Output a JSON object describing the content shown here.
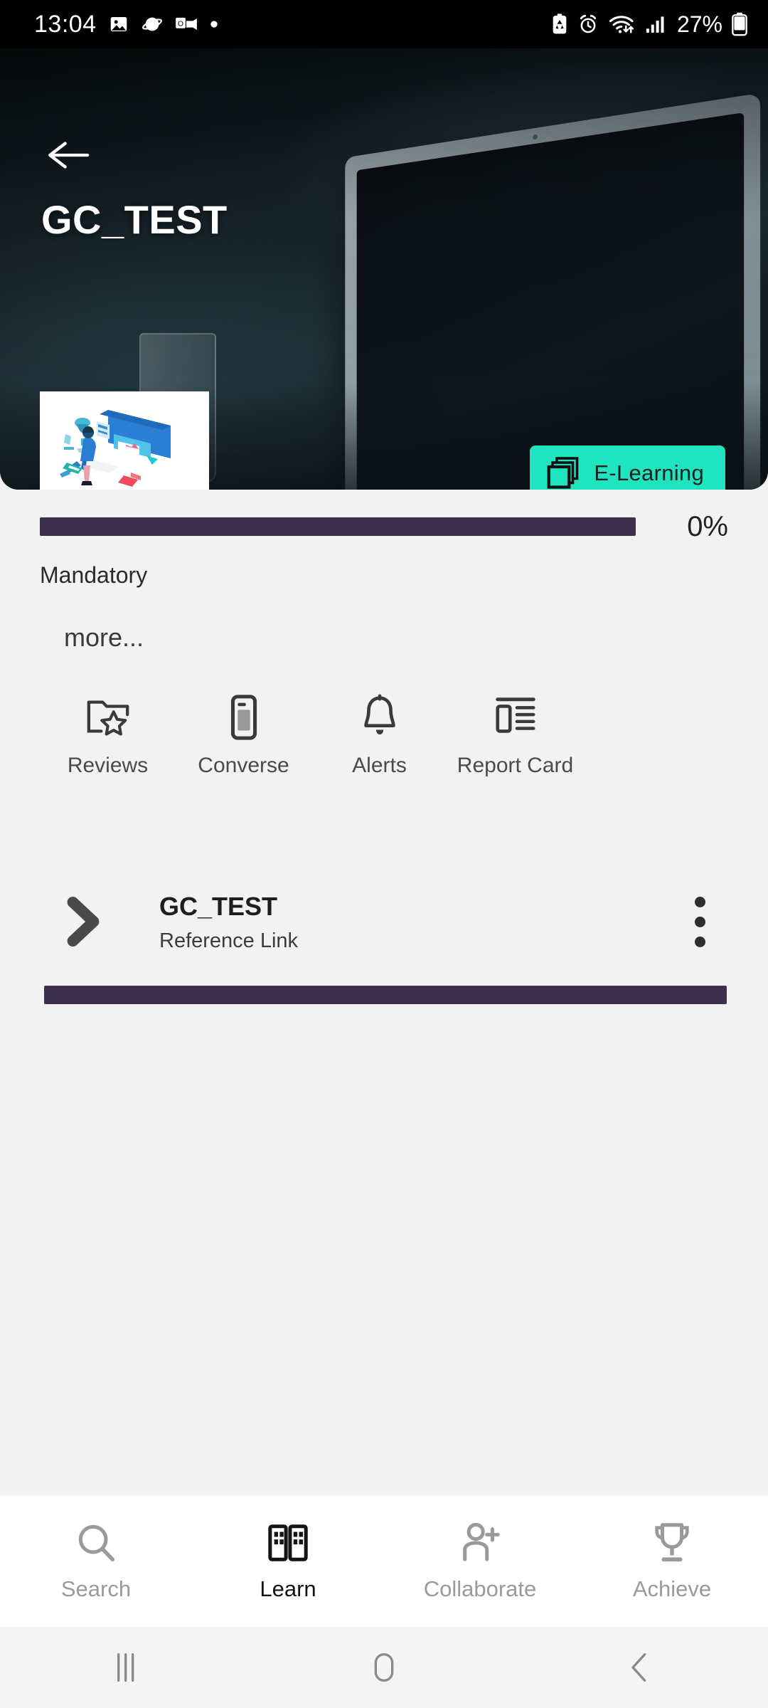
{
  "statusbar": {
    "time": "13:04",
    "battery_percent": "27%",
    "left_icons": [
      "photo-icon",
      "browser-planet-icon",
      "outlook-meeting-icon",
      "dot-icon"
    ],
    "right_icons": [
      "battery-saver-icon",
      "alarm-icon",
      "wifi-icon",
      "signal-icon",
      "battery-icon"
    ]
  },
  "hero": {
    "back_icon": "back-arrow-icon",
    "title": "GC_TEST",
    "thumbnail_alt": "course-thumbnail",
    "badge": {
      "label": "E-Learning",
      "icon": "stacked-squares-icon",
      "color": "#20e3c0"
    }
  },
  "progress": {
    "percent_label": "0%",
    "percent_value": 0,
    "track_color": "#3b2f4c",
    "category": "Mandatory",
    "more_label": "more..."
  },
  "actions": [
    {
      "label": "Reviews",
      "icon": "folder-star-icon"
    },
    {
      "label": "Converse",
      "icon": "mobile-phone-icon"
    },
    {
      "label": "Alerts",
      "icon": "bell-icon"
    },
    {
      "label": "Report Card",
      "icon": "report-card-icon"
    }
  ],
  "content_row": {
    "chevron_icon": "chevron-right-icon",
    "title": "GC_TEST",
    "subtitle": "Reference Link",
    "overflow_icon": "three-dot-menu-icon"
  },
  "bottom_nav": {
    "items": [
      {
        "label": "Search",
        "icon": "search-icon",
        "active": false
      },
      {
        "label": "Learn",
        "icon": "book-icon",
        "active": true
      },
      {
        "label": "Collaborate",
        "icon": "person-add-icon",
        "active": false
      },
      {
        "label": "Achieve",
        "icon": "trophy-icon",
        "active": false
      }
    ]
  },
  "system_nav": {
    "recents_icon": "recents-icon",
    "home_icon": "home-icon",
    "back_icon": "system-back-icon"
  }
}
